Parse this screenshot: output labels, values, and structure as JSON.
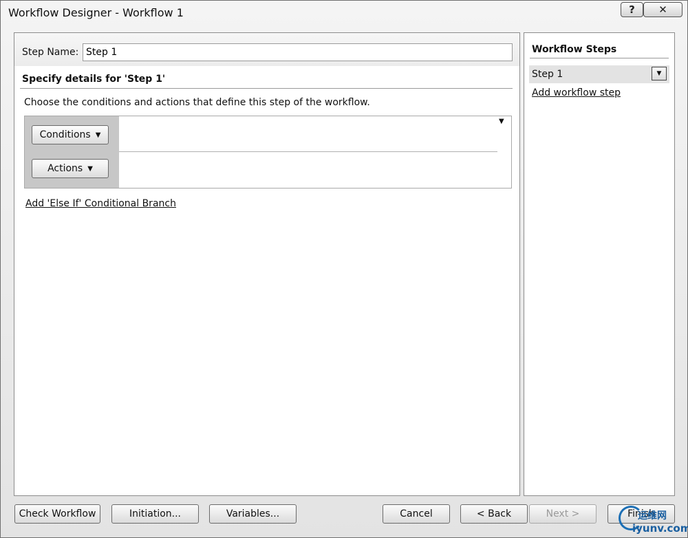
{
  "window": {
    "title": "Workflow Designer - Workflow 1",
    "help_glyph": "?",
    "close_glyph": "✕"
  },
  "step_name": {
    "label": "Step Name:",
    "value": "Step 1"
  },
  "details": {
    "heading": "Specify details for 'Step 1'",
    "instructions": "Choose the conditions and actions that define this step of the workflow.",
    "conditions_button": "Conditions",
    "actions_button": "Actions",
    "caret": "▼",
    "else_if_link": "Add 'Else If' Conditional Branch"
  },
  "steps_pane": {
    "heading": "Workflow Steps",
    "items": [
      {
        "label": "Step 1"
      }
    ],
    "dropdown_glyph": "▼",
    "add_step_link": "Add workflow step"
  },
  "buttons": {
    "check_workflow": "Check Workflow",
    "initiation": "Initiation...",
    "variables": "Variables...",
    "cancel": "Cancel",
    "back": "< Back",
    "next": "Next >",
    "finish": "Finish"
  },
  "watermark": {
    "top_text": "运维网",
    "bottom_text": "iyunv.com"
  },
  "colors": {
    "condition_panel_bg": "#c7c7c7",
    "step_item_bg": "#e3e3e3",
    "watermark_blue": "#1c6fb5"
  }
}
